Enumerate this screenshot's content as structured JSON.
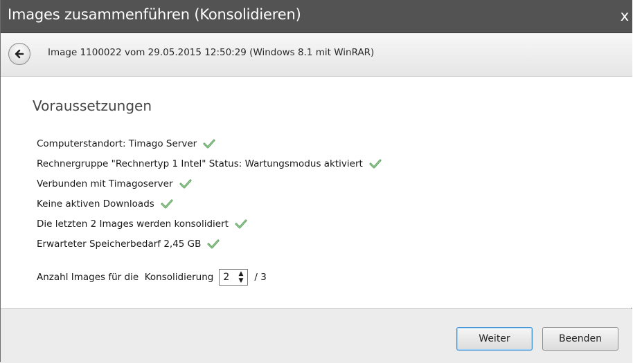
{
  "window": {
    "title": "Images zusammenführen (Konsolidieren)",
    "close_glyph": "x"
  },
  "nav": {
    "back_icon": "back-arrow-icon",
    "image_info": "Image 1100022 vom 29.05.2015 12:50:29 (Windows 8.1 mit WinRAR)"
  },
  "section": {
    "title": "Voraussetzungen"
  },
  "requirements": [
    {
      "text": "Computerstandort: Timago Server",
      "status_icon": "checkmark-icon"
    },
    {
      "text": "Rechnergruppe \"Rechnertyp 1 Intel\" Status: Wartungsmodus aktiviert",
      "status_icon": "checkmark-icon"
    },
    {
      "text": "Verbunden mit Timagoserver",
      "status_icon": "checkmark-icon"
    },
    {
      "text": "Keine aktiven Downloads",
      "status_icon": "checkmark-icon"
    },
    {
      "text": "Die letzten 2 Images werden konsolidiert",
      "status_icon": "checkmark-icon"
    },
    {
      "text": "Erwarteter Speicherbedarf 2,45 GB",
      "status_icon": "checkmark-icon"
    }
  ],
  "count": {
    "label": "Anzahl Images für die  Konsolidierung",
    "value": "2",
    "total": "/ 3"
  },
  "buttons": {
    "next": "Weiter",
    "quit": "Beenden"
  },
  "colors": {
    "titlebar": "#535353",
    "check": "#5fa05f",
    "primary_border": "#3b8fd6"
  }
}
